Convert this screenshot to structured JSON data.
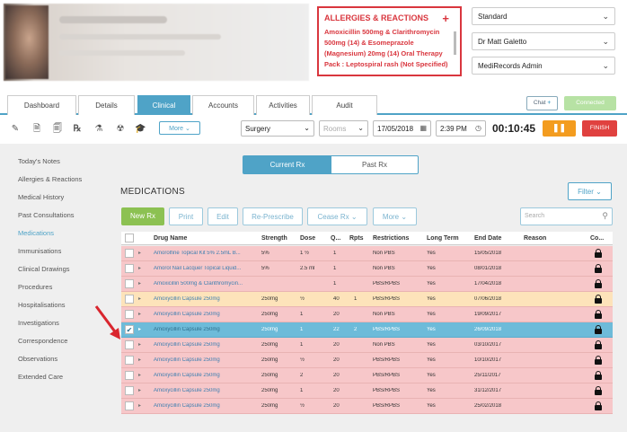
{
  "allergies": {
    "title": "ALLERGIES & REACTIONS",
    "text": "Amoxicillin 500mg & Clarithromycin 500mg (14) & Esomeprazole (Magnesium) 20mg (14) Oral Therapy Pack : Leptospiral rash (Not Specified)"
  },
  "selects": {
    "appointment_type": "Standard",
    "doctor": "Dr Matt Galetto",
    "user": "MediRecords Admin"
  },
  "tabs": [
    {
      "label": "Dashboard"
    },
    {
      "label": "Details"
    },
    {
      "label": "Clinical"
    },
    {
      "label": "Accounts"
    },
    {
      "label": "Activities"
    },
    {
      "label": "Audit"
    }
  ],
  "chat_label": "Chat",
  "connected_label": "Connected",
  "toolbar": {
    "more_label": "More",
    "location": "Surgery",
    "rooms_placeholder": "Rooms",
    "date": "17/05/2018",
    "time": "2:39 PM",
    "timer": "00:10:45",
    "finish_label": "FINISH"
  },
  "sidebar": [
    "Today's Notes",
    "Allergies & Reactions",
    "Medical History",
    "Past Consultations",
    "Medications",
    "Immunisations",
    "Clinical Drawings",
    "Procedures",
    "Hospitalisations",
    "Investigations",
    "Correspondence",
    "Observations",
    "Extended Care"
  ],
  "rx_toggle": {
    "current": "Current Rx",
    "past": "Past Rx"
  },
  "medications": {
    "title": "MEDICATIONS",
    "filter_label": "Filter",
    "actions": {
      "new_rx": "New Rx",
      "print": "Print",
      "edit": "Edit",
      "represcribe": "Re-Prescribe",
      "cease": "Cease Rx",
      "more": "More"
    },
    "search_placeholder": "Search",
    "columns": [
      "Drug Name",
      "Strength",
      "Dose",
      "Q...",
      "Rpts",
      "Restrictions",
      "Long Term",
      "End Date",
      "Reason",
      "Co..."
    ],
    "rows": [
      {
        "drug": "Amorolfine Topical Kit 5% 2.5mL B...",
        "strength": "5%",
        "dose": "1 ½",
        "qty": "1",
        "rpts": "",
        "restrictions": "Non PBS",
        "long_term": "Yes",
        "end_date": "15/05/2018",
        "status": "red",
        "checked": false
      },
      {
        "drug": "Amorol Nail Lacquer Topical Liquid...",
        "strength": "5%",
        "dose": "2.5 ml",
        "qty": "1",
        "rpts": "",
        "restrictions": "Non PBS",
        "long_term": "Yes",
        "end_date": "08/01/2018",
        "status": "red",
        "checked": false
      },
      {
        "drug": "Amoxicillin 500mg & Clarithromycin...",
        "strength": "",
        "dose": "",
        "qty": "1",
        "rpts": "",
        "restrictions": "PBS/RPBS",
        "long_term": "Yes",
        "end_date": "17/04/2018",
        "status": "red",
        "checked": false
      },
      {
        "drug": "Amoxycillin Capsule 250mg",
        "strength": "250mg",
        "dose": "½",
        "qty": "40",
        "rpts": "1",
        "restrictions": "PBS/RPBS",
        "long_term": "Yes",
        "end_date": "07/06/2018",
        "status": "orange",
        "checked": false
      },
      {
        "drug": "Amoxycillin Capsule 250mg",
        "strength": "250mg",
        "dose": "1",
        "qty": "20",
        "rpts": "",
        "restrictions": "Non PBS",
        "long_term": "Yes",
        "end_date": "19/09/2017",
        "status": "red",
        "checked": false
      },
      {
        "drug": "Amoxycillin Capsule 250mg",
        "strength": "250mg",
        "dose": "1",
        "qty": "22",
        "rpts": "2",
        "restrictions": "PBS/RPBS",
        "long_term": "Yes",
        "end_date": "26/09/2018",
        "status": "selected",
        "checked": true
      },
      {
        "drug": "Amoxycillin Capsule 250mg",
        "strength": "250mg",
        "dose": "1",
        "qty": "20",
        "rpts": "",
        "restrictions": "Non PBS",
        "long_term": "Yes",
        "end_date": "03/10/2017",
        "status": "red",
        "checked": false
      },
      {
        "drug": "Amoxycillin Capsule 250mg",
        "strength": "250mg",
        "dose": "½",
        "qty": "20",
        "rpts": "",
        "restrictions": "PBS/RPBS",
        "long_term": "Yes",
        "end_date": "10/10/2017",
        "status": "red",
        "checked": false
      },
      {
        "drug": "Amoxycillin Capsule 250mg",
        "strength": "250mg",
        "dose": "2",
        "qty": "20",
        "rpts": "",
        "restrictions": "PBS/RPBS",
        "long_term": "Yes",
        "end_date": "25/11/2017",
        "status": "red",
        "checked": false
      },
      {
        "drug": "Amoxycillin Capsule 250mg",
        "strength": "250mg",
        "dose": "1",
        "qty": "20",
        "rpts": "",
        "restrictions": "PBS/RPBS",
        "long_term": "Yes",
        "end_date": "31/12/2017",
        "status": "red",
        "checked": false
      },
      {
        "drug": "Amoxycillin Capsule 250mg",
        "strength": "250mg",
        "dose": "½",
        "qty": "20",
        "rpts": "",
        "restrictions": "PBS/RPBS",
        "long_term": "Yes",
        "end_date": "25/02/2018",
        "status": "red",
        "checked": false
      }
    ]
  },
  "colors": {
    "accent": "#4fa3c7",
    "red_row": "#f7c7c9",
    "orange_row": "#fde3ba",
    "selected_row": "#6dbbd9",
    "allergy_red": "#d9363e",
    "new_rx_green": "#8cc152"
  }
}
